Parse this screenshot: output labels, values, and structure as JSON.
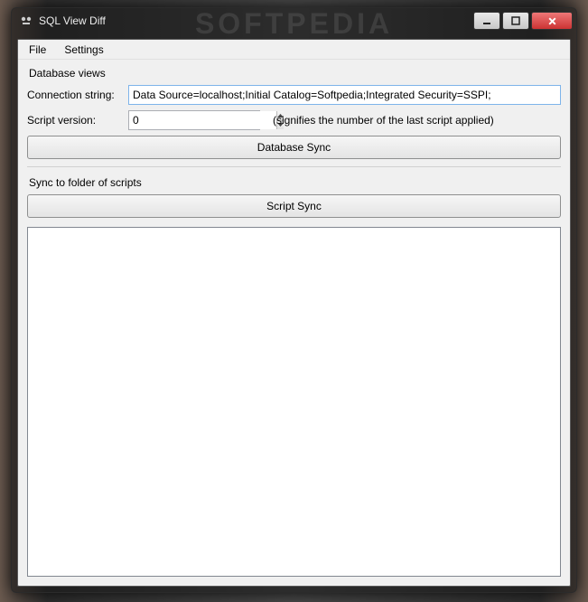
{
  "window": {
    "title": "SQL View Diff"
  },
  "menubar": {
    "items": [
      "File",
      "Settings"
    ]
  },
  "database_views": {
    "group_label": "Database views",
    "connection_label": "Connection string:",
    "connection_value": "Data Source=localhost;Initial Catalog=Softpedia;Integrated Security=SSPI;",
    "script_version_label": "Script version:",
    "script_version_value": "0",
    "script_version_hint": "(signifies the number of the last script applied)",
    "db_sync_button": "Database Sync"
  },
  "script_sync": {
    "group_label": "Sync to folder of scripts",
    "button": "Script Sync"
  },
  "backdrop_text": "SOFTPEDIA"
}
